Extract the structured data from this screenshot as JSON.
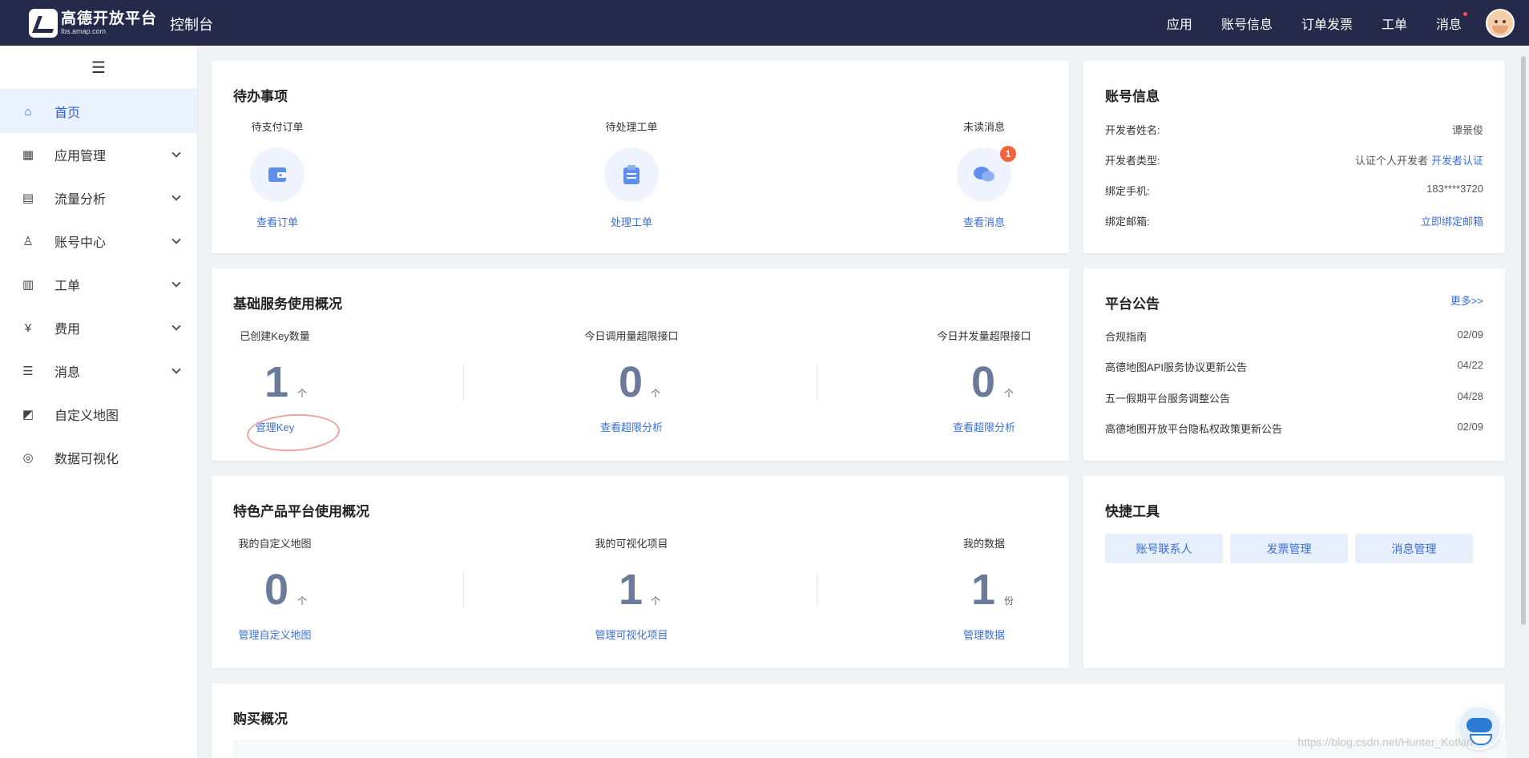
{
  "header": {
    "logo_cn": "高德开放平台",
    "logo_en": "lbs.amap.com",
    "title": "控制台",
    "nav": [
      "应用",
      "账号信息",
      "订单发票",
      "工单",
      "消息"
    ]
  },
  "sidebar": {
    "toggle": "☰",
    "items": [
      {
        "label": "首页",
        "icon": "⌂"
      },
      {
        "label": "应用管理",
        "icon": "▦"
      },
      {
        "label": "流量分析",
        "icon": "▤"
      },
      {
        "label": "账号中心",
        "icon": "♙"
      },
      {
        "label": "工单",
        "icon": "▥"
      },
      {
        "label": "费用",
        "icon": "¥"
      },
      {
        "label": "消息",
        "icon": "☰"
      },
      {
        "label": "自定义地图",
        "icon": "◩"
      },
      {
        "label": "数据可视化",
        "icon": "◎"
      }
    ]
  },
  "todo": {
    "title": "待办事项",
    "items": [
      {
        "label": "待支付订单",
        "link": "查看订单"
      },
      {
        "label": "待处理工单",
        "link": "处理工单"
      },
      {
        "label": "未读消息",
        "link": "查看消息",
        "badge": "1"
      }
    ]
  },
  "account": {
    "title": "账号信息",
    "rows": [
      {
        "key": "开发者姓名:",
        "value": "谭景俊"
      },
      {
        "key": "开发者类型:",
        "value": "认证个人开发者",
        "link": "开发者认证"
      },
      {
        "key": "绑定手机:",
        "value": "183****3720"
      },
      {
        "key": "绑定邮箱:",
        "link": "立即绑定邮箱"
      }
    ]
  },
  "basic": {
    "title": "基础服务使用概况",
    "stats": [
      {
        "label": "已创建Key数量",
        "value": "1",
        "unit": "个",
        "link": "管理Key"
      },
      {
        "label": "今日调用量超限接口",
        "value": "0",
        "unit": "个",
        "link": "查看超限分析"
      },
      {
        "label": "今日并发量超限接口",
        "value": "0",
        "unit": "个",
        "link": "查看超限分析"
      }
    ]
  },
  "notice": {
    "title": "平台公告",
    "more": "更多>>",
    "items": [
      {
        "title": "合规指南",
        "date": "02/09"
      },
      {
        "title": "高德地图API服务协议更新公告",
        "date": "04/22"
      },
      {
        "title": "五一假期平台服务调整公告",
        "date": "04/28"
      },
      {
        "title": "高德地图开放平台隐私权政策更新公告",
        "date": "02/09"
      }
    ]
  },
  "special": {
    "title": "特色产品平台使用概况",
    "stats": [
      {
        "label": "我的自定义地图",
        "value": "0",
        "unit": "个",
        "link": "管理自定义地图"
      },
      {
        "label": "我的可视化项目",
        "value": "1",
        "unit": "个",
        "link": "管理可视化项目"
      },
      {
        "label": "我的数据",
        "value": "1",
        "unit": "份",
        "link": "管理数据"
      }
    ]
  },
  "quick": {
    "title": "快捷工具",
    "buttons": [
      "账号联系人",
      "发票管理",
      "消息管理"
    ]
  },
  "purchase": {
    "title": "购买概况"
  },
  "watermark": "https://blog.csdn.net/Hunter_Kotlan",
  "colors": {
    "topbar": "#252a4a",
    "accent": "#3a6fd8",
    "active_bg": "#eaf2ff",
    "badge": "#f4613d",
    "stat": "#6b7a9a"
  }
}
